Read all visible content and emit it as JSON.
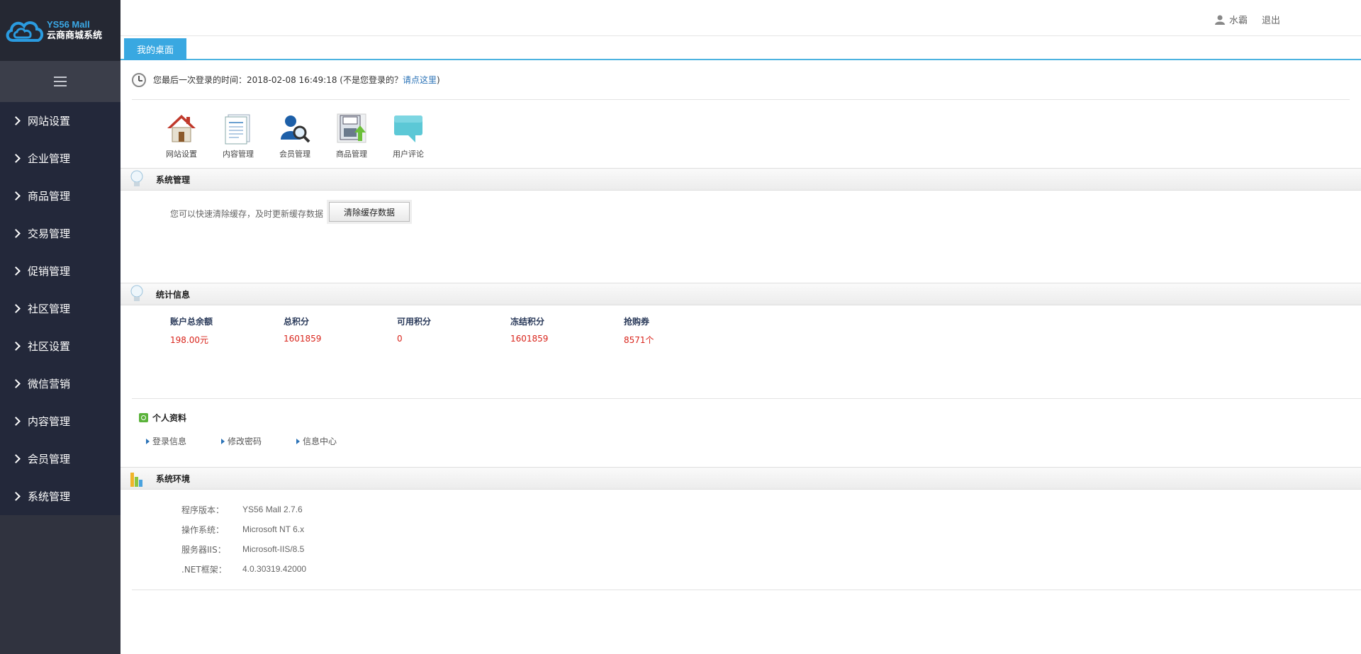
{
  "brand": {
    "name_en": "YS56 Mall",
    "name_cn": "云商商城系统",
    "accent": "#3aa8e6"
  },
  "sidebar": {
    "items": [
      {
        "label": "网站设置"
      },
      {
        "label": "企业管理"
      },
      {
        "label": "商品管理"
      },
      {
        "label": "交易管理"
      },
      {
        "label": "促销管理"
      },
      {
        "label": "社区管理"
      },
      {
        "label": "社区设置"
      },
      {
        "label": "微信营销"
      },
      {
        "label": "内容管理"
      },
      {
        "label": "会员管理"
      },
      {
        "label": "系统管理"
      }
    ]
  },
  "header": {
    "username": "水霸",
    "logout": "退出"
  },
  "tabs": [
    {
      "label": "我的桌面"
    }
  ],
  "last_login": {
    "prefix": "您最后一次登录的时间：2018-02-08 16:49:18 (不是您登录的？",
    "link": "请点这里",
    "suffix": ")"
  },
  "quick_links": [
    {
      "label": "网站设置",
      "icon": "house-icon"
    },
    {
      "label": "内容管理",
      "icon": "document-icon"
    },
    {
      "label": "会员管理",
      "icon": "member-search-icon"
    },
    {
      "label": "商品管理",
      "icon": "product-upload-icon"
    },
    {
      "label": "用户评论",
      "icon": "speech-bubble-icon"
    }
  ],
  "system_management": {
    "title": "系统管理",
    "text": "您可以快速清除缓存，及时更新缓存数据",
    "button": "清除缓存数据"
  },
  "statistics": {
    "title": "统计信息",
    "columns": [
      {
        "label": "账户总余额",
        "value": "198.00元"
      },
      {
        "label": "总积分",
        "value": "1601859"
      },
      {
        "label": "可用积分",
        "value": "0"
      },
      {
        "label": "冻结积分",
        "value": "1601859"
      },
      {
        "label": "抢购券",
        "value": "8571个"
      }
    ]
  },
  "profile": {
    "title": "个人资料",
    "links": [
      {
        "label": "登录信息"
      },
      {
        "label": "修改密码"
      },
      {
        "label": "信息中心"
      }
    ]
  },
  "environment": {
    "title": "系统环境",
    "rows": [
      {
        "label": "程序版本：",
        "value": "YS56 Mall 2.7.6"
      },
      {
        "label": "操作系统：",
        "value": "Microsoft NT 6.x"
      },
      {
        "label": "服务器IIS：",
        "value": "Microsoft-IIS/8.5"
      },
      {
        "label": ".NET框架：",
        "value": "4.0.30319.42000"
      }
    ]
  }
}
